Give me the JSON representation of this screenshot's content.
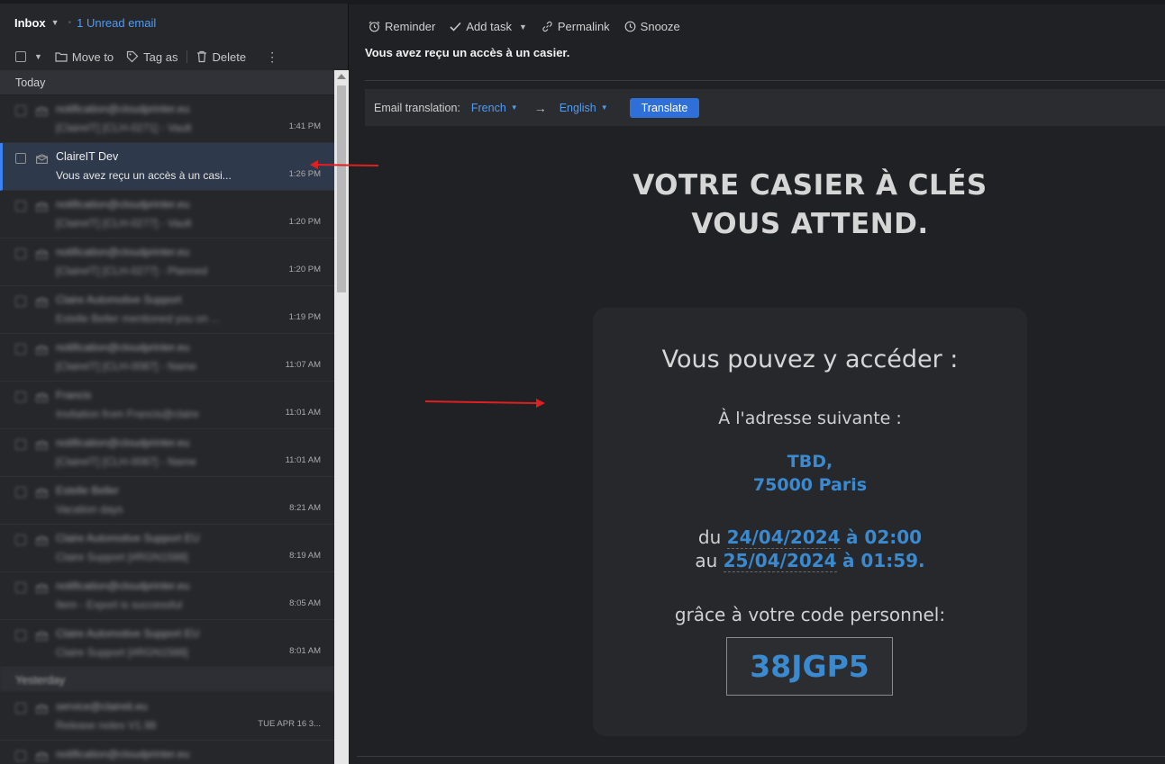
{
  "inbox": {
    "title": "Inbox",
    "unread": "1 Unread email"
  },
  "toolbar": {
    "move_to": "Move to",
    "tag_as": "Tag as",
    "delete": "Delete"
  },
  "groups": {
    "today": "Today",
    "yesterday": "Yesterday"
  },
  "emails": [
    {
      "sender": "notification@cloudprinter.eu",
      "subject": "[ClaireIT] [CLH-0271] - Vault",
      "time": "1:41 PM",
      "blurred": true
    },
    {
      "sender": "ClaireIT Dev",
      "subject": "Vous avez reçu un accès à un casi...",
      "time": "1:26 PM",
      "blurred": false
    },
    {
      "sender": "notification@cloudprinter.eu",
      "subject": "[ClaireIT] [CLH-0277] - Vault",
      "time": "1:20 PM",
      "blurred": true
    },
    {
      "sender": "notification@cloudprinter.eu",
      "subject": "[ClaireIT] [CLH-0277] - Planned",
      "time": "1:20 PM",
      "blurred": true
    },
    {
      "sender": "Claire Automotive Support",
      "subject": "Estelle Beller mentioned you on ...",
      "time": "1:19 PM",
      "blurred": true
    },
    {
      "sender": "notification@cloudprinter.eu",
      "subject": "[ClaireIT] [CLH-0087] - Name",
      "time": "11:07 AM",
      "blurred": true
    },
    {
      "sender": "Francis",
      "subject": "Invitation from Francis@claire",
      "time": "11:01 AM",
      "blurred": true
    },
    {
      "sender": "notification@cloudprinter.eu",
      "subject": "[ClaireIT] [CLH-0087] - Name",
      "time": "11:01 AM",
      "blurred": true
    },
    {
      "sender": "Estelle Beller",
      "subject": "Vacation days",
      "time": "8:21 AM",
      "blurred": true
    },
    {
      "sender": "Claire Automotive Support EU",
      "subject": "Claire Support [#RGN1588]",
      "time": "8:19 AM",
      "blurred": true
    },
    {
      "sender": "notification@cloudprinter.eu",
      "subject": "Item - Export is successful",
      "time": "8:05 AM",
      "blurred": true
    },
    {
      "sender": "Claire Automotive Support EU",
      "subject": "Claire Support [#RGN1588]",
      "time": "8:01 AM",
      "blurred": true
    }
  ],
  "yesterday_emails": [
    {
      "sender": "service@claireit.eu",
      "subject": "Release notes V1.98",
      "time": "TUE APR 16 3...",
      "blurred": true
    },
    {
      "sender": "notification@cloudprinter.eu",
      "subject": "",
      "time": "",
      "blurred": true
    }
  ],
  "reader": {
    "actions": {
      "reminder": "Reminder",
      "add_task": "Add task",
      "permalink": "Permalink",
      "snooze": "Snooze"
    },
    "subject": "Vous avez reçu un accès à un casier."
  },
  "translation": {
    "label": "Email translation:",
    "from": "French",
    "to": "English",
    "button": "Translate"
  },
  "body": {
    "headline_1": "VOTRE CASIER À CLÉS",
    "headline_2": "VOUS ATTEND.",
    "access_title": "Vous pouvez y accéder :",
    "address_label": "À l'adresse suivante :",
    "address_1": "TBD,",
    "address_2": "75000 Paris",
    "from_word": "du",
    "from_date": "24/04/2024",
    "from_time": "à 02:00",
    "to_word": "au",
    "to_date": "25/04/2024",
    "to_time": "à 01:59.",
    "code_label": "grâce à votre code personnel:",
    "code": "38JGP5"
  },
  "colors": {
    "accent": "#3b82f6",
    "link_blue": "#4f9cf5",
    "body_blue": "#3b8ad0",
    "annotation_red": "#e02020"
  }
}
